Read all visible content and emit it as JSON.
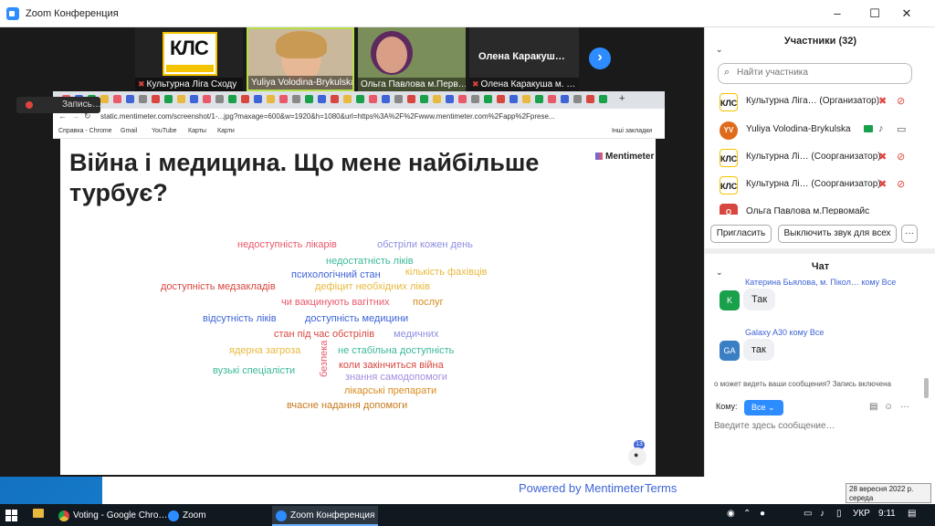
{
  "window": {
    "title": "Zoom Конференция",
    "min": "–",
    "max": "☐",
    "close": "✕"
  },
  "video_strip": {
    "tiles": [
      {
        "label": "Культурна Ліга Сходу",
        "logo_text": "КЛС",
        "muted": true
      },
      {
        "label": "Yuliya Volodina-Brykulska",
        "muted": false
      },
      {
        "label": "Ольга Павлова м.Перв…",
        "muted": false
      },
      {
        "label": "Олена Каракуша м. …",
        "big_name": "Олена  Каракуш…",
        "muted": true
      }
    ],
    "next": "›"
  },
  "recording": {
    "text": "Запись…"
  },
  "browser": {
    "url": "static.mentimeter.com/screenshot/1-...jpg?maxage=600&w=1920&h=1080&url=https%3A%2F%2Fwww.mentimeter.com%2Fapp%2Fprese...",
    "bookmarks": [
      "Справка - Chrome",
      "Gmail",
      "YouTube",
      "Карты",
      "Карти"
    ],
    "other_bookmarks": "Інші закладки"
  },
  "slide": {
    "title": "Війна і медицина. Що мене найбільше турбує?",
    "brand": "Mentimeter",
    "participants_count": "13",
    "words": [
      {
        "text": "недоступність лікарів",
        "color": "#e8596b"
      },
      {
        "text": "обстріли кожен день",
        "color": "#8e8ee0"
      },
      {
        "text": "недостатність ліків",
        "color": "#3bb89a"
      },
      {
        "text": "психологічний стан",
        "color": "#3e64d6"
      },
      {
        "text": "кількість фахівців",
        "color": "#e7b93e"
      },
      {
        "text": "доступність медзакладів",
        "color": "#d7473f"
      },
      {
        "text": "дефіцит необхідних ліків",
        "color": "#e7b93e"
      },
      {
        "text": "чи вакцинують вагітних",
        "color": "#e8596b"
      },
      {
        "text": "послуг",
        "color": "#d98a1e"
      },
      {
        "text": "відсутність ліків",
        "color": "#3e64d6"
      },
      {
        "text": "доступність медицини",
        "color": "#3e64d6"
      },
      {
        "text": "стан під час обстрілів",
        "color": "#d7473f"
      },
      {
        "text": "медичних",
        "color": "#8e8ee0"
      },
      {
        "text": "ядерна загроза",
        "color": "#e7b93e"
      },
      {
        "text": "не стабільна доступність",
        "color": "#3bb89a"
      },
      {
        "text": "безпека",
        "color": "#e8596b"
      },
      {
        "text": "коли закінчиться війна",
        "color": "#d7473f"
      },
      {
        "text": "вузькі спеціалісти",
        "color": "#3bb89a"
      },
      {
        "text": "знання самодопомоги",
        "color": "#a58de0"
      },
      {
        "text": "лікарські препарати",
        "color": "#d98a1e"
      },
      {
        "text": "вчасне надання допомоги",
        "color": "#c77a1e"
      }
    ]
  },
  "participants": {
    "header": "Участники (32)",
    "search_placeholder": "Найти участника",
    "list": [
      {
        "name": "Культурна Ліга… (Организатор)",
        "avatar": "КЛС",
        "avatar_color": "#ffffff",
        "logo": true
      },
      {
        "name": "Yuliya Volodina-Brykulska",
        "avatar": "YV",
        "avatar_color": "#e06a1b",
        "logo": false
      },
      {
        "name": "Культурна Лі… (Соорганизатор)",
        "avatar": "КЛС",
        "avatar_color": "#ffffff",
        "logo": true
      },
      {
        "name": "Культурна Лі… (Соорганизатор)",
        "avatar": "КЛС",
        "avatar_color": "#ffffff",
        "logo": true
      },
      {
        "name": "Ольга Павлова м.Первомайс",
        "avatar": "О",
        "avatar_color": "#d7473f",
        "logo": false
      }
    ],
    "invite": "Пригласить",
    "mute_all": "Выключить звук для всех",
    "more": "···"
  },
  "chat": {
    "header": "Чат",
    "messages": [
      {
        "from": "Катерина Бьялова, м. Пікол…  кому Все",
        "avatar": "K",
        "avatar_color": "#19a04b",
        "text": "Так"
      },
      {
        "from": "Galaxy A30 кому Все",
        "avatar": "GA",
        "avatar_color": "#3a7fc4",
        "text": "так"
      }
    ],
    "notice": "о может видеть ваши сообщения? Запись включена",
    "to_label": "Кому:",
    "to_value": "Все",
    "input_placeholder": "Введите здесь сообщение…"
  },
  "page_footer": {
    "powered": "Powered by Mentimeter",
    "terms": "Terms"
  },
  "taskbar": {
    "tasks": [
      "Voting - Google Chro…",
      "Zoom",
      "Zoom Конференция"
    ],
    "lang": "УКР",
    "time": "9:11"
  },
  "tooltip": {
    "date": "28 вересня 2022 р.",
    "day": "середа"
  }
}
